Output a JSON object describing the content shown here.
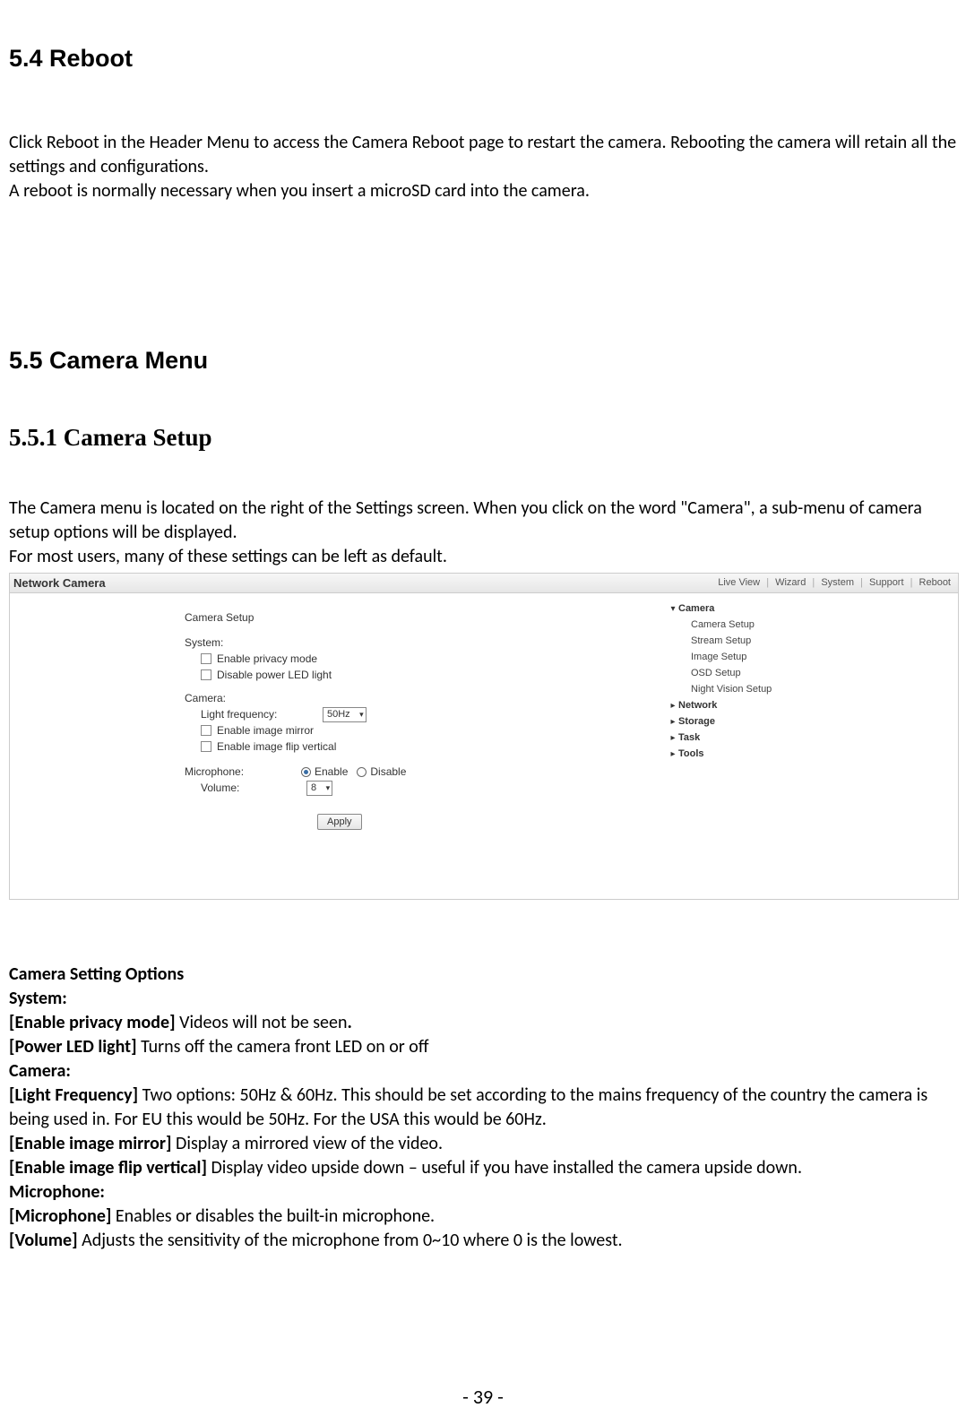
{
  "sec54": {
    "heading": "5.4 Reboot",
    "p1": "Click Reboot in the Header Menu to access the Camera Reboot page to restart the camera. Rebooting the camera will retain all the settings and configurations.",
    "p2": "A reboot is normally necessary when you insert a microSD card into the camera."
  },
  "sec55": {
    "heading": "5.5 Camera Menu"
  },
  "sec551": {
    "heading": "5.5.1 Camera Setup",
    "p1": "The Camera menu is located on the right of the Settings screen. When you click on the word \"Camera\", a sub-menu of camera setup options will be displayed.",
    "p2": "For most users, many of these settings can be left as default."
  },
  "screenshot": {
    "app_title": "Network Camera",
    "header_menu": [
      "Live View",
      "Wizard",
      "System",
      "Support",
      "Reboot"
    ],
    "main": {
      "title": "Camera Setup",
      "system_label": "System:",
      "system_opts": [
        "Enable privacy mode",
        "Disable power LED light"
      ],
      "camera_label": "Camera:",
      "light_freq_label": "Light frequency:",
      "light_freq_value": "50Hz",
      "camera_opts": [
        "Enable image mirror",
        "Enable image flip vertical"
      ],
      "mic_label": "Microphone:",
      "mic_enable": "Enable",
      "mic_disable": "Disable",
      "volume_label": "Volume:",
      "volume_value": "8",
      "apply": "Apply"
    },
    "side": {
      "camera": "Camera",
      "camera_subs": [
        "Camera Setup",
        "Stream Setup",
        "Image Setup",
        "OSD Setup",
        "Night Vision Setup"
      ],
      "network": "Network",
      "storage": "Storage",
      "task": "Task",
      "tools": "Tools"
    }
  },
  "opts": {
    "heading": "Camera Setting Options",
    "system": "System:",
    "privacy_b": "[Enable privacy mode] ",
    "privacy_t": "Videos will not be seen",
    "privacy_dot": ".",
    "led_b": "[Power LED light] ",
    "led_t": "Turns off the camera front LED on or off",
    "camera": "Camera:",
    "lf_b": "[Light Frequency] ",
    "lf_t": "Two options: 50Hz & 60Hz. This should be set according to the mains frequency of the country the camera is being used in. For EU this would be 50Hz. For the USA this would be 60Hz.",
    "mirror_b": "[Enable image mirror] ",
    "mirror_t": "Display a mirrored view of the video.",
    "flip_b": "[Enable image flip vertical] ",
    "flip_t": "Display video upside down – useful if you have installed the camera upside down.",
    "mic": "Microphone:",
    "micopt_b": "[Microphone] ",
    "micopt_t": "Enables or disables the built-in microphone.",
    "vol_b": "[Volume] ",
    "vol_t": "Adjusts the sensitivity of the microphone from 0~10 where 0 is the lowest."
  },
  "page_number": "- 39 -",
  "chart_data": {
    "type": "table",
    "title": "Camera Setup form state",
    "rows": [
      {
        "group": "System",
        "field": "Enable privacy mode",
        "value": "unchecked"
      },
      {
        "group": "System",
        "field": "Disable power LED light",
        "value": "unchecked"
      },
      {
        "group": "Camera",
        "field": "Light frequency",
        "value": "50Hz"
      },
      {
        "group": "Camera",
        "field": "Enable image mirror",
        "value": "unchecked"
      },
      {
        "group": "Camera",
        "field": "Enable image flip vertical",
        "value": "unchecked"
      },
      {
        "group": "Microphone",
        "field": "Microphone",
        "value": "Enable"
      },
      {
        "group": "Microphone",
        "field": "Volume",
        "value": "8"
      }
    ]
  }
}
